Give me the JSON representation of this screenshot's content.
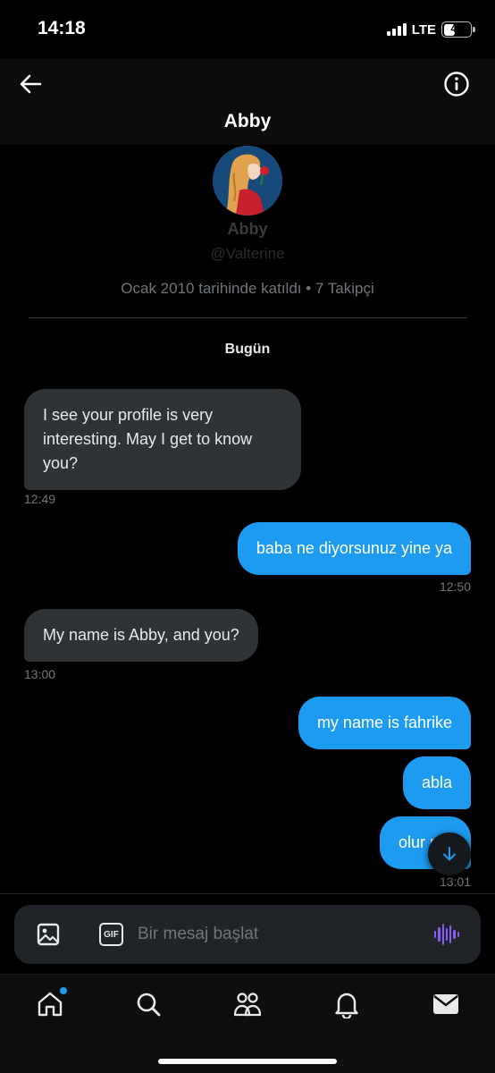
{
  "status_bar": {
    "time": "14:18",
    "network": "LTE",
    "battery": "44"
  },
  "header": {
    "title": "Abby"
  },
  "profile": {
    "name": "Abby",
    "handle": "@Valterine",
    "meta": "Ocak 2010 tarihinde katıldı • 7 Takipçi"
  },
  "date_label": "Bugün",
  "messages": [
    {
      "side": "in",
      "text": "I see your profile is very interesting. May I get to know you?",
      "time": "12:49"
    },
    {
      "side": "out",
      "text": "baba ne diyorsunuz yine ya",
      "time": "12:50"
    },
    {
      "side": "in",
      "text": "My name is Abby, and you?",
      "time": "13:00"
    },
    {
      "side": "out",
      "text": "my name is fahrike",
      "time": ""
    },
    {
      "side": "out",
      "text": "abla",
      "time": ""
    },
    {
      "side": "out",
      "text": "olur mu",
      "time": "13:01"
    }
  ],
  "composer": {
    "placeholder": "Bir mesaj başlat",
    "gif_label": "GIF"
  },
  "colors": {
    "accent": "#1d9bf0",
    "incoming_bubble": "#2f3336",
    "voice": "#8a5cf6"
  },
  "nav": [
    "home-icon",
    "search-icon",
    "communities-icon",
    "notifications-icon",
    "messages-icon"
  ]
}
